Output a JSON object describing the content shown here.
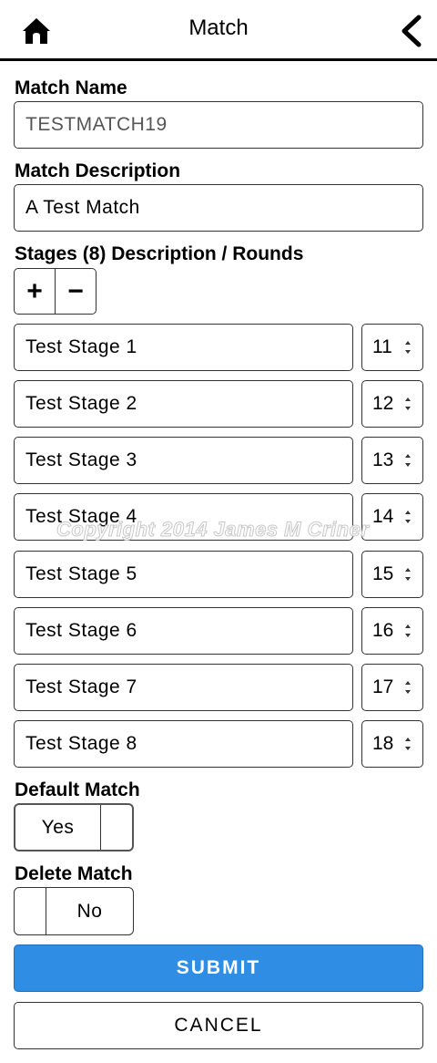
{
  "header": {
    "title": "Match",
    "home_icon": "home-icon",
    "back_icon": "chevron-left-icon"
  },
  "form": {
    "match_name_label": "Match Name",
    "match_name_value": "TESTMATCH19",
    "match_description_label": "Match Description",
    "match_description_value": "A Test Match",
    "stages_label": "Stages (8) Description / Rounds",
    "add_stage": "+",
    "remove_stage": "−",
    "stages": [
      {
        "description": "Test Stage 1",
        "rounds": "11"
      },
      {
        "description": "Test Stage 2",
        "rounds": "12"
      },
      {
        "description": "Test Stage 3",
        "rounds": "13"
      },
      {
        "description": "Test Stage 4",
        "rounds": "14"
      },
      {
        "description": "Test Stage 5",
        "rounds": "15"
      },
      {
        "description": "Test Stage 6",
        "rounds": "16"
      },
      {
        "description": "Test Stage 7",
        "rounds": "17"
      },
      {
        "description": "Test Stage 8",
        "rounds": "18"
      }
    ],
    "default_match_label": "Default Match",
    "default_match_value": "Yes",
    "delete_match_label": "Delete Match",
    "delete_match_value": "No"
  },
  "actions": {
    "submit": "SUBMIT",
    "cancel": "CANCEL"
  },
  "watermark": "Copyright 2014 James M Criner",
  "colors": {
    "submit_bg": "#2f8de4"
  }
}
